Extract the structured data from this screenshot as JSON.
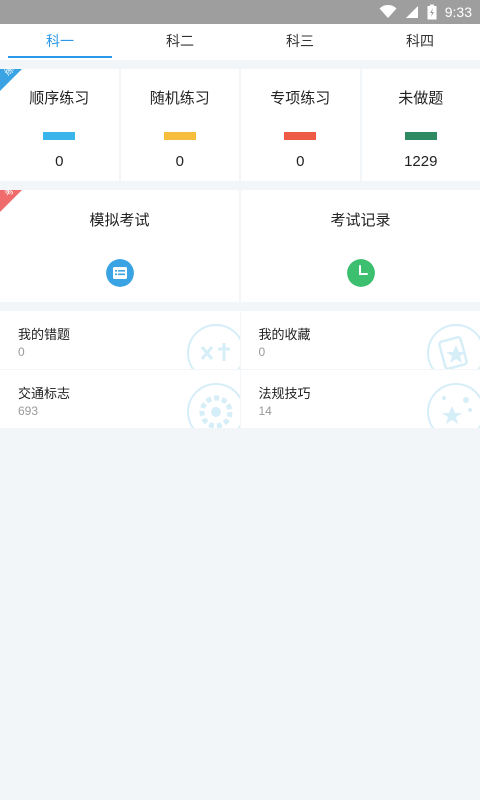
{
  "status_bar": {
    "time": "9:33",
    "icons": [
      "wifi-icon",
      "signal-icon",
      "battery-charging-icon"
    ]
  },
  "tabs": [
    {
      "label": "科一",
      "active": true
    },
    {
      "label": "科二",
      "active": false
    },
    {
      "label": "科三",
      "active": false
    },
    {
      "label": "科四",
      "active": false
    }
  ],
  "practice": {
    "corner_tag": "练",
    "corner_color": "#3aa3e3",
    "items": [
      {
        "label": "顺序练习",
        "count": "0",
        "color": "#3ab5ec"
      },
      {
        "label": "随机练习",
        "count": "0",
        "color": "#f5bd3b"
      },
      {
        "label": "专项练习",
        "count": "0",
        "color": "#ef5a45"
      },
      {
        "label": "未做题",
        "count": "1229",
        "color": "#2e8a63"
      }
    ]
  },
  "exam": {
    "corner_tag": "考",
    "corner_color": "#f06b6b",
    "items": [
      {
        "label": "模拟考试",
        "icon": "exam-paper-icon",
        "color": "#3aa3e3"
      },
      {
        "label": "考试记录",
        "icon": "clock-icon",
        "color": "#3cbf6f"
      }
    ]
  },
  "collections": [
    {
      "label": "我的错题",
      "count": "0",
      "icon": "wrong-answer-icon"
    },
    {
      "label": "我的收藏",
      "count": "0",
      "icon": "favorite-star-icon"
    },
    {
      "label": "交通标志",
      "count": "693",
      "icon": "traffic-sign-icon"
    },
    {
      "label": "法规技巧",
      "count": "14",
      "icon": "tips-stars-icon"
    }
  ]
}
